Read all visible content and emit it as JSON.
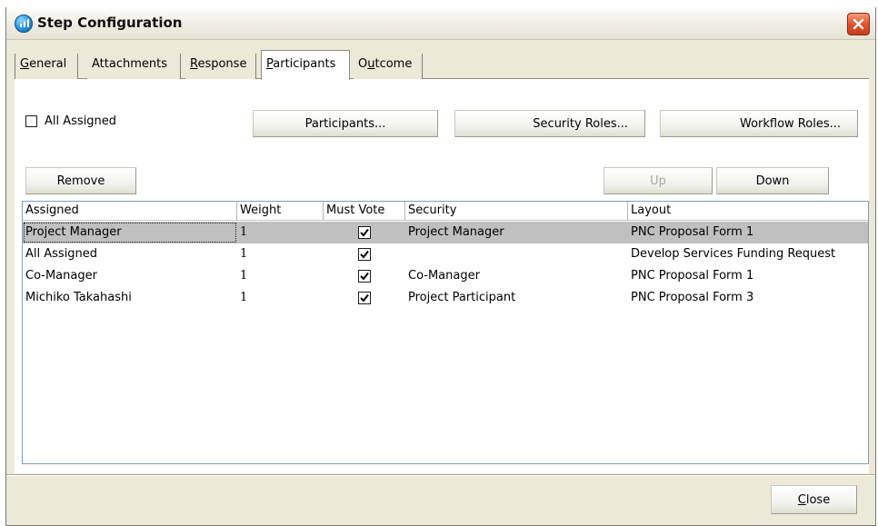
{
  "window": {
    "title": "Step Configuration",
    "accent": "#2a8fd6",
    "close_icon": "close-icon"
  },
  "tabs": [
    {
      "label": "General",
      "mnemonic": "G",
      "rest": "eneral"
    },
    {
      "label": "Attachments",
      "mnemonic": "",
      "rest": "Attachments"
    },
    {
      "label": "Response",
      "mnemonic": "R",
      "rest": "esponse"
    },
    {
      "label": "Participants",
      "mnemonic": "P",
      "rest": "articipants",
      "active": true
    },
    {
      "label": "Outcome",
      "mnemonic": "O",
      "pre": "O",
      "mnemonic_mid": "u",
      "rest": "tcome"
    }
  ],
  "toolbar": {
    "all_assigned_label": "All Assigned",
    "all_assigned_checked": false,
    "participants_button": "Participants...",
    "security_roles_button": "Security Roles...",
    "workflow_roles_button": "Workflow Roles...",
    "remove_button": "Remove",
    "up_button": "Up",
    "down_button": "Down"
  },
  "grid": {
    "columns": [
      "Assigned",
      "Weight",
      "Must Vote",
      "Security",
      "Layout"
    ],
    "rows": [
      {
        "assigned": "Project Manager",
        "weight": "1",
        "must_vote": true,
        "security": "Project Manager",
        "layout": "PNC Proposal Form 1",
        "selected": true
      },
      {
        "assigned": "All Assigned",
        "weight": "1",
        "must_vote": true,
        "security": "",
        "layout": "Develop Services Funding Request"
      },
      {
        "assigned": "Co-Manager",
        "weight": "1",
        "must_vote": true,
        "security": "Co-Manager",
        "layout": "PNC Proposal Form 1"
      },
      {
        "assigned": "Michiko Takahashi",
        "weight": "1",
        "must_vote": true,
        "security": "Project Participant",
        "layout": "PNC Proposal Form 3"
      }
    ]
  },
  "footer": {
    "close_button_mnemonic": "C",
    "close_button_rest": "lose"
  }
}
